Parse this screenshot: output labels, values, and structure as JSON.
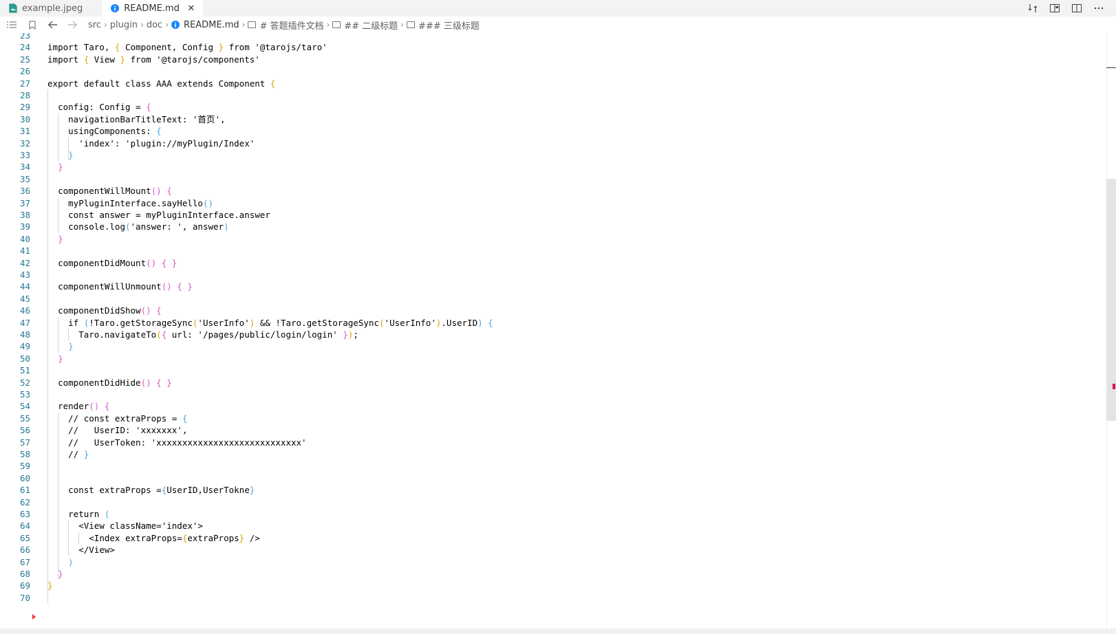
{
  "tabs": [
    {
      "label": "example.jpeg",
      "icon": "image-file-icon",
      "active": false
    },
    {
      "label": "README.md",
      "icon": "info-icon",
      "active": true,
      "close": "✕"
    }
  ],
  "breadcrumb": {
    "items": [
      "src",
      "plugin",
      "doc"
    ],
    "file": "README.md",
    "headings": [
      "# 答题插件文档",
      "## 二级标题",
      "### 三级标题"
    ]
  },
  "colors": {
    "line_number": "#237893",
    "bracket_yellow": "#d7a500",
    "bracket_magenta": "#d957c8",
    "bracket_blue": "#41a9e8",
    "info_icon": "#1a85ff"
  },
  "editor": {
    "lines": [
      {
        "n": "23",
        "t": ""
      },
      {
        "n": "24",
        "t": "import Taro, { Component, Config } from '@tarojs/taro'"
      },
      {
        "n": "25",
        "t": "import { View } from '@tarojs/components'"
      },
      {
        "n": "26",
        "t": ""
      },
      {
        "n": "27",
        "t": "export default class AAA extends Component {"
      },
      {
        "n": "28",
        "t": ""
      },
      {
        "n": "29",
        "t": "  config: Config = {"
      },
      {
        "n": "30",
        "t": "    navigationBarTitleText: '首页',"
      },
      {
        "n": "31",
        "t": "    usingComponents: {"
      },
      {
        "n": "32",
        "t": "      'index': 'plugin://myPlugin/Index'"
      },
      {
        "n": "33",
        "t": "    }"
      },
      {
        "n": "34",
        "t": "  }"
      },
      {
        "n": "35",
        "t": ""
      },
      {
        "n": "36",
        "t": "  componentWillMount() {"
      },
      {
        "n": "37",
        "t": "    myPluginInterface.sayHello()"
      },
      {
        "n": "38",
        "t": "    const answer = myPluginInterface.answer"
      },
      {
        "n": "39",
        "t": "    console.log('answer: ', answer)"
      },
      {
        "n": "40",
        "t": "  }"
      },
      {
        "n": "41",
        "t": ""
      },
      {
        "n": "42",
        "t": "  componentDidMount() { }"
      },
      {
        "n": "43",
        "t": ""
      },
      {
        "n": "44",
        "t": "  componentWillUnmount() { }"
      },
      {
        "n": "45",
        "t": ""
      },
      {
        "n": "46",
        "t": "  componentDidShow() {"
      },
      {
        "n": "47",
        "t": "    if (!Taro.getStorageSync('UserInfo') && !Taro.getStorageSync('UserInfo').UserID) {"
      },
      {
        "n": "48",
        "t": "      Taro.navigateTo({ url: '/pages/public/login/login' });"
      },
      {
        "n": "49",
        "t": "    }"
      },
      {
        "n": "50",
        "t": "  }"
      },
      {
        "n": "51",
        "t": ""
      },
      {
        "n": "52",
        "t": "  componentDidHide() { }"
      },
      {
        "n": "53",
        "t": ""
      },
      {
        "n": "54",
        "t": "  render() {"
      },
      {
        "n": "55",
        "t": "    // const extraProps = {"
      },
      {
        "n": "56",
        "t": "    //   UserID: 'xxxxxxx',"
      },
      {
        "n": "57",
        "t": "    //   UserToken: 'xxxxxxxxxxxxxxxxxxxxxxxxxxxx'"
      },
      {
        "n": "58",
        "t": "    // }"
      },
      {
        "n": "59",
        "t": ""
      },
      {
        "n": "60",
        "t": ""
      },
      {
        "n": "61",
        "t": "    const extraProps ={UserID,UserTokne}"
      },
      {
        "n": "62",
        "t": ""
      },
      {
        "n": "63",
        "t": "    return ("
      },
      {
        "n": "64",
        "t": "      <View className='index'>"
      },
      {
        "n": "65",
        "t": "        <Index extraProps={extraProps} />"
      },
      {
        "n": "66",
        "t": "      </View>"
      },
      {
        "n": "67",
        "t": "    )"
      },
      {
        "n": "68",
        "t": "  }"
      },
      {
        "n": "69",
        "t": "}"
      },
      {
        "n": "70",
        "t": ""
      }
    ]
  }
}
